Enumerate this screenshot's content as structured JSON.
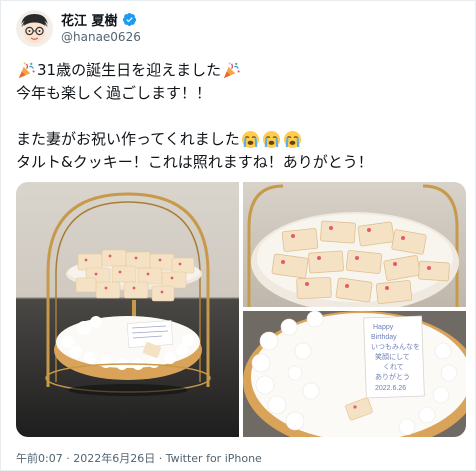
{
  "author": {
    "display_name": "花江 夏樹",
    "handle": "@hanae0626"
  },
  "tweet": {
    "lines": [
      {
        "pre_emoji": "party-popper",
        "text": "31歳の誕生日を迎えました",
        "post_emoji": [
          "party-popper"
        ]
      },
      {
        "text": "今年も楽しく過ごします！！"
      },
      {
        "text": ""
      },
      {
        "text": "また妻がお祝い作ってくれました",
        "post_emoji": [
          "crying-face",
          "crying-face",
          "crying-face"
        ]
      },
      {
        "text": "タルト&クッキー！これは照れますね！ありがとう！"
      }
    ]
  },
  "media": {
    "photos": [
      {
        "description": "tart-stand-photo"
      },
      {
        "description": "cookies-closeup-photo"
      },
      {
        "description": "tart-message-plate-photo"
      }
    ],
    "plate_message": [
      "Happy",
      "Birthday",
      "いつもみんなを",
      "笑顔にして",
      "くれて",
      "ありがとう",
      "2022.6.26"
    ]
  },
  "meta": {
    "time": "午前0:07",
    "separator": "·",
    "date": "2022年6月26日",
    "source": "Twitter for iPhone"
  },
  "colors": {
    "verified": "#1d9bf0",
    "text": "#0f1419",
    "secondary": "#536471",
    "border": "#e6ecf0"
  }
}
